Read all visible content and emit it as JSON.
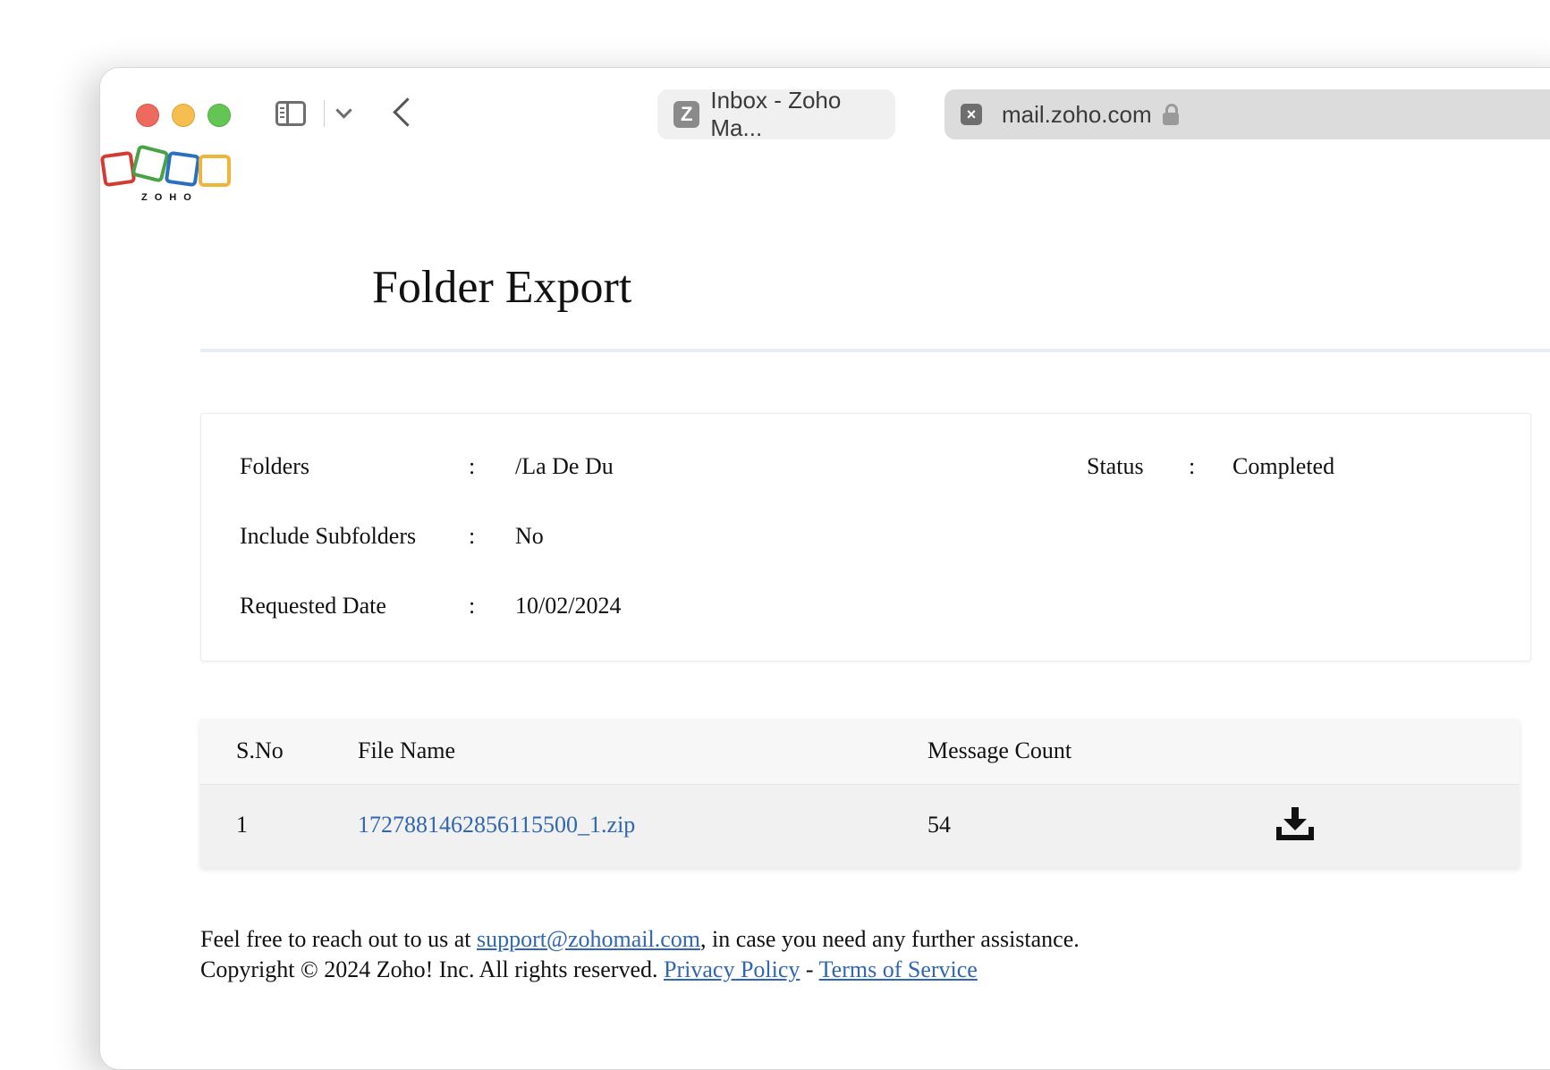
{
  "browser": {
    "tab_inbox_favicon": "Z",
    "tab_inbox_title": "Inbox - Zoho Ma...",
    "tab_url_close": "×",
    "tab_url": "mail.zoho.com"
  },
  "brand": {
    "logo_text": "ZOHO",
    "colors": [
      "#d33b35",
      "#4aa248",
      "#2a70c0",
      "#efb53a"
    ]
  },
  "page": {
    "title": "Folder Export"
  },
  "info": {
    "folders_label": "Folders",
    "folders_value": "/La De Du",
    "subfolders_label": "Include Subfolders",
    "subfolders_value": "No",
    "date_label": "Requested Date",
    "date_value": "10/02/2024",
    "status_label": "Status",
    "status_value": "Completed",
    "separator": ":"
  },
  "table": {
    "headers": [
      "S.No",
      "File Name",
      "Message Count"
    ],
    "rows": [
      {
        "sno": "1",
        "file_name": "1727881462856115500_1.zip",
        "message_count": "54",
        "action_icon": "download-icon"
      }
    ]
  },
  "footer": {
    "line1_prefix": "Feel free to reach out to us at ",
    "support_email": "support@zohomail.com",
    "line1_suffix": ", in case you need any further assistance.",
    "copyright": "Copyright © 2024 Zoho! Inc. All rights reserved. ",
    "privacy_link": "Privacy Policy",
    "dash": " - ",
    "terms_link": "Terms of Service"
  },
  "colors": {
    "link": "#2f67b1",
    "traffic_red": "#ee6a5f",
    "traffic_yellow": "#f5be4f",
    "traffic_green": "#62c554"
  }
}
